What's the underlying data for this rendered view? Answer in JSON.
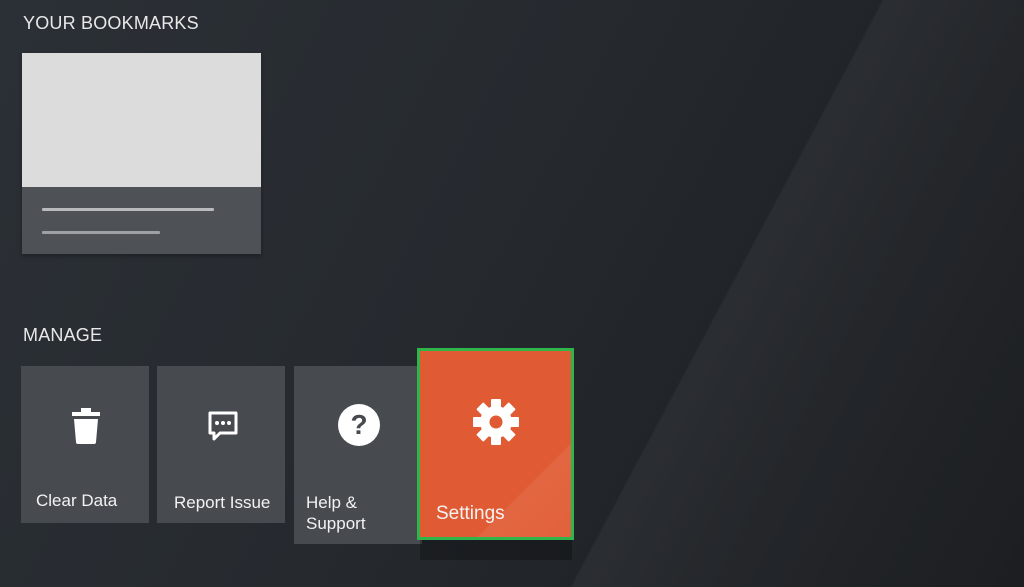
{
  "bookmarks": {
    "title": "YOUR BOOKMARKS"
  },
  "manage": {
    "title": "MANAGE",
    "tiles": [
      {
        "label": "Clear Data",
        "icon": "trash-icon"
      },
      {
        "label": "Report Issue",
        "icon": "message-icon"
      },
      {
        "label_line1": "Help &",
        "label_line2": "Support",
        "icon": "help-icon"
      },
      {
        "label": "Settings",
        "icon": "gear-icon",
        "selected": true
      }
    ]
  },
  "colors": {
    "background": "#262a2f",
    "tile": "#474b50",
    "settings_tile": "#e05b33",
    "focus_border": "#2fb54a"
  }
}
